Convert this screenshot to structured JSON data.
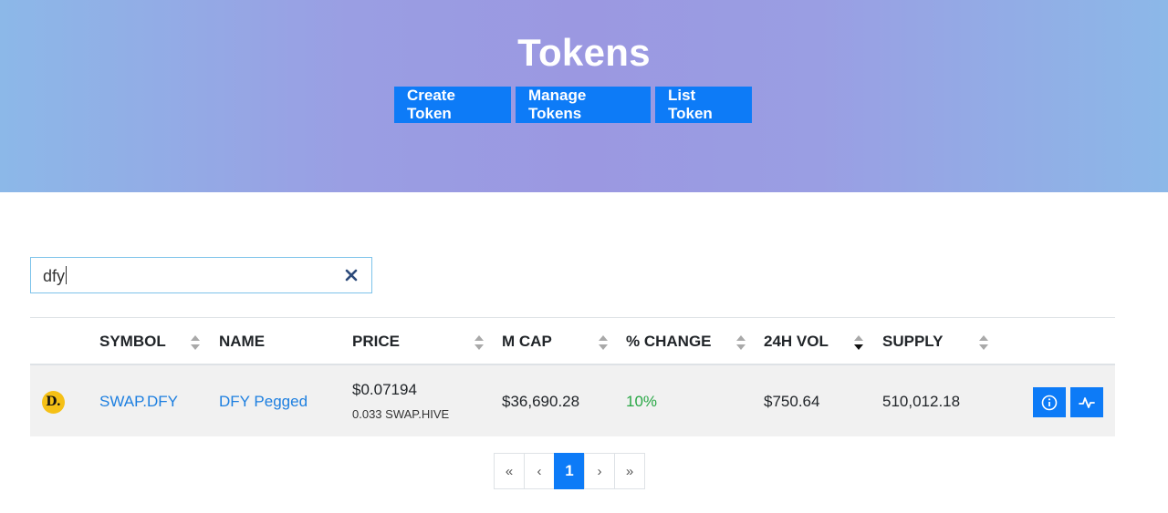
{
  "hero": {
    "title": "Tokens",
    "buttons": {
      "create": "Create Token",
      "manage": "Manage Tokens",
      "list": "List Token"
    },
    "accent_color": "#0d7bf7"
  },
  "search": {
    "value": "dfy",
    "clear_icon": "close-icon"
  },
  "table": {
    "columns": [
      "SYMBOL",
      "NAME",
      "PRICE",
      "M CAP",
      "% CHANGE",
      "24H VOL",
      "SUPPLY"
    ],
    "sorted_column": "24H VOL",
    "sorted_direction": "descending",
    "rows": [
      {
        "logo": "D.",
        "symbol": "SWAP.DFY",
        "name": "DFY Pegged",
        "price": "$0.07194",
        "price_hive": "0.033 SWAP.HIVE",
        "mcap": "$36,690.28",
        "change": "10%",
        "volume": "$750.64",
        "supply": "510,012.18",
        "actions": [
          "info-icon",
          "activity-chart-icon"
        ]
      }
    ]
  },
  "pagination": {
    "first": "«",
    "prev": "‹",
    "current": "1",
    "next": "›",
    "last": "»"
  }
}
